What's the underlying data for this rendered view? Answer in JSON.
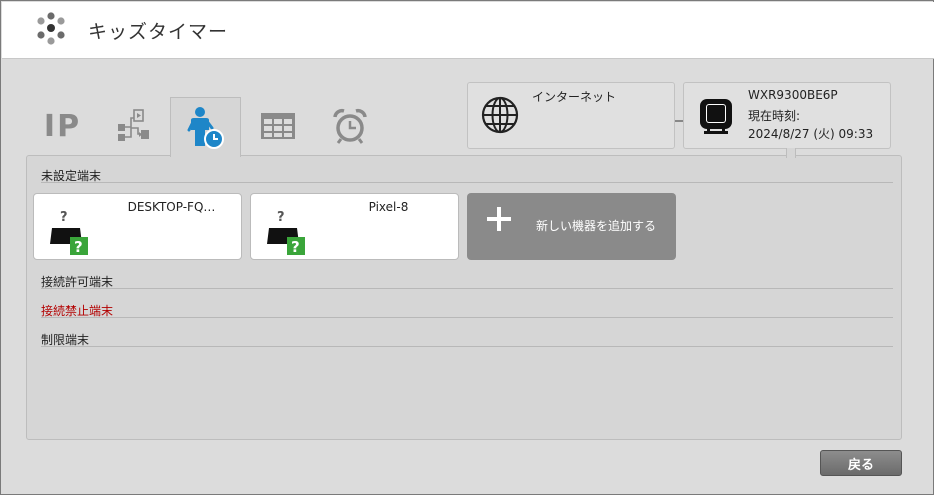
{
  "header": {
    "title": "キッズタイマー",
    "logo_icon": "dots-spinner-icon"
  },
  "tabs": [
    {
      "id": "ip",
      "label": "IP"
    },
    {
      "id": "network",
      "icon": "network-flow-icon"
    },
    {
      "id": "kids-timer",
      "icon": "child-clock-icon",
      "active": true
    },
    {
      "id": "schedule",
      "icon": "calendar-grid-icon"
    },
    {
      "id": "alarm",
      "icon": "alarm-clock-icon"
    }
  ],
  "internet": {
    "label": "インターネット",
    "icon": "globe-icon"
  },
  "router": {
    "model": "WXR9300BE6P",
    "time_label": "現在時刻:",
    "time_value": "2024/8/27 (火) 09:33",
    "icon": "router-icon"
  },
  "sections": {
    "unset": "未設定端末",
    "allowed": "接続許可端末",
    "blocked": "接続禁止端末",
    "restricted": "制限端末"
  },
  "devices": [
    {
      "name": "DESKTOP-FQ…",
      "icon": "unknown-device-icon"
    },
    {
      "name": "Pixel-8",
      "icon": "unknown-device-icon"
    }
  ],
  "add_device": {
    "label": "新しい機器を追加する",
    "icon": "plus-icon"
  },
  "footer": {
    "back_label": "戻る"
  },
  "colors": {
    "blocked_text": "#b30000",
    "active_icon": "#1e86c8",
    "badge_green": "#3aa53a"
  }
}
